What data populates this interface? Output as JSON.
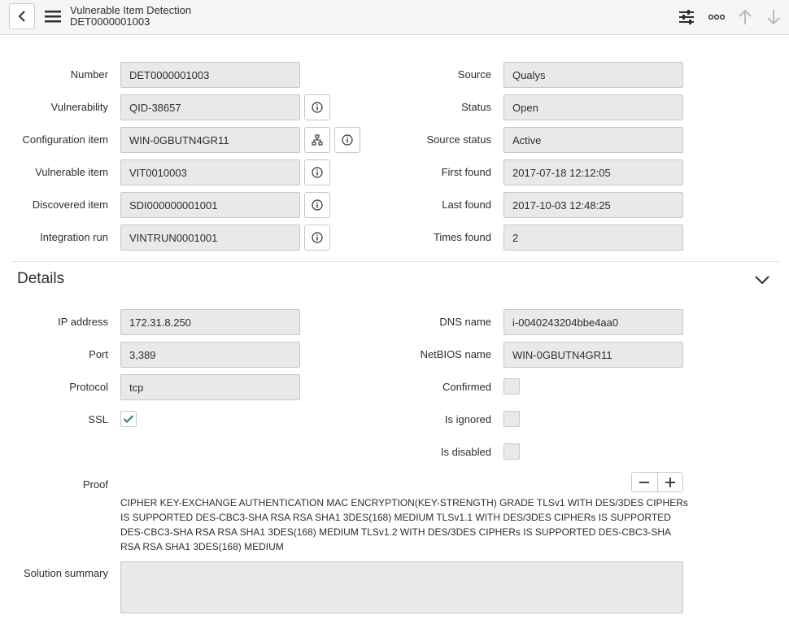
{
  "header": {
    "title": "Vulnerable Item Detection",
    "subtitle": "DET0000001003",
    "icons": [
      "back-icon",
      "menu-icon",
      "settings-sliders-icon",
      "more-icon",
      "arrow-up-icon",
      "arrow-down-icon"
    ]
  },
  "form": {
    "number": {
      "label": "Number",
      "value": "DET0000001003"
    },
    "vulnerability": {
      "label": "Vulnerability",
      "value": "QID-38657"
    },
    "configuration_item": {
      "label": "Configuration item",
      "value": "WIN-0GBUTN4GR11"
    },
    "vulnerable_item": {
      "label": "Vulnerable item",
      "value": "VIT0010003"
    },
    "discovered_item": {
      "label": "Discovered item",
      "value": "SDI000000001001"
    },
    "integration_run": {
      "label": "Integration run",
      "value": "VINTRUN0001001"
    },
    "source": {
      "label": "Source",
      "value": "Qualys"
    },
    "status": {
      "label": "Status",
      "value": "Open"
    },
    "source_status": {
      "label": "Source status",
      "value": "Active"
    },
    "first_found": {
      "label": "First found",
      "value": "2017-07-18 12:12:05"
    },
    "last_found": {
      "label": "Last found",
      "value": "2017-10-03 12:48:25"
    },
    "times_found": {
      "label": "Times found",
      "value": "2"
    }
  },
  "details": {
    "title": "Details",
    "ip_address": {
      "label": "IP address",
      "value": "172.31.8.250"
    },
    "port": {
      "label": "Port",
      "value": "3,389"
    },
    "protocol": {
      "label": "Protocol",
      "value": "tcp"
    },
    "ssl": {
      "label": "SSL",
      "checked": true
    },
    "dns_name": {
      "label": "DNS name",
      "value": "i-0040243204bbe4aa0"
    },
    "netbios_name": {
      "label": "NetBIOS name",
      "value": "WIN-0GBUTN4GR11"
    },
    "confirmed": {
      "label": "Confirmed",
      "checked": false
    },
    "is_ignored": {
      "label": "Is ignored",
      "checked": false
    },
    "is_disabled": {
      "label": "Is disabled",
      "checked": false
    },
    "proof": {
      "label": "Proof",
      "text": "CIPHER KEY-EXCHANGE AUTHENTICATION MAC ENCRYPTION(KEY-STRENGTH) GRADE TLSv1 WITH DES/3DES CIPHERs IS SUPPORTED DES-CBC3-SHA RSA RSA SHA1 3DES(168) MEDIUM TLSv1.1 WITH DES/3DES CIPHERs IS SUPPORTED DES-CBC3-SHA RSA RSA SHA1 3DES(168) MEDIUM TLSv1.2 WITH DES/3DES CIPHERs IS SUPPORTED DES-CBC3-SHA RSA RSA SHA1 3DES(168) MEDIUM"
    },
    "solution_summary": {
      "label": "Solution summary",
      "value": ""
    }
  },
  "colors": {
    "field_bg": "#e9e9e9",
    "header_bg": "#f6f6f6",
    "check_accent": "#2a7e74"
  }
}
